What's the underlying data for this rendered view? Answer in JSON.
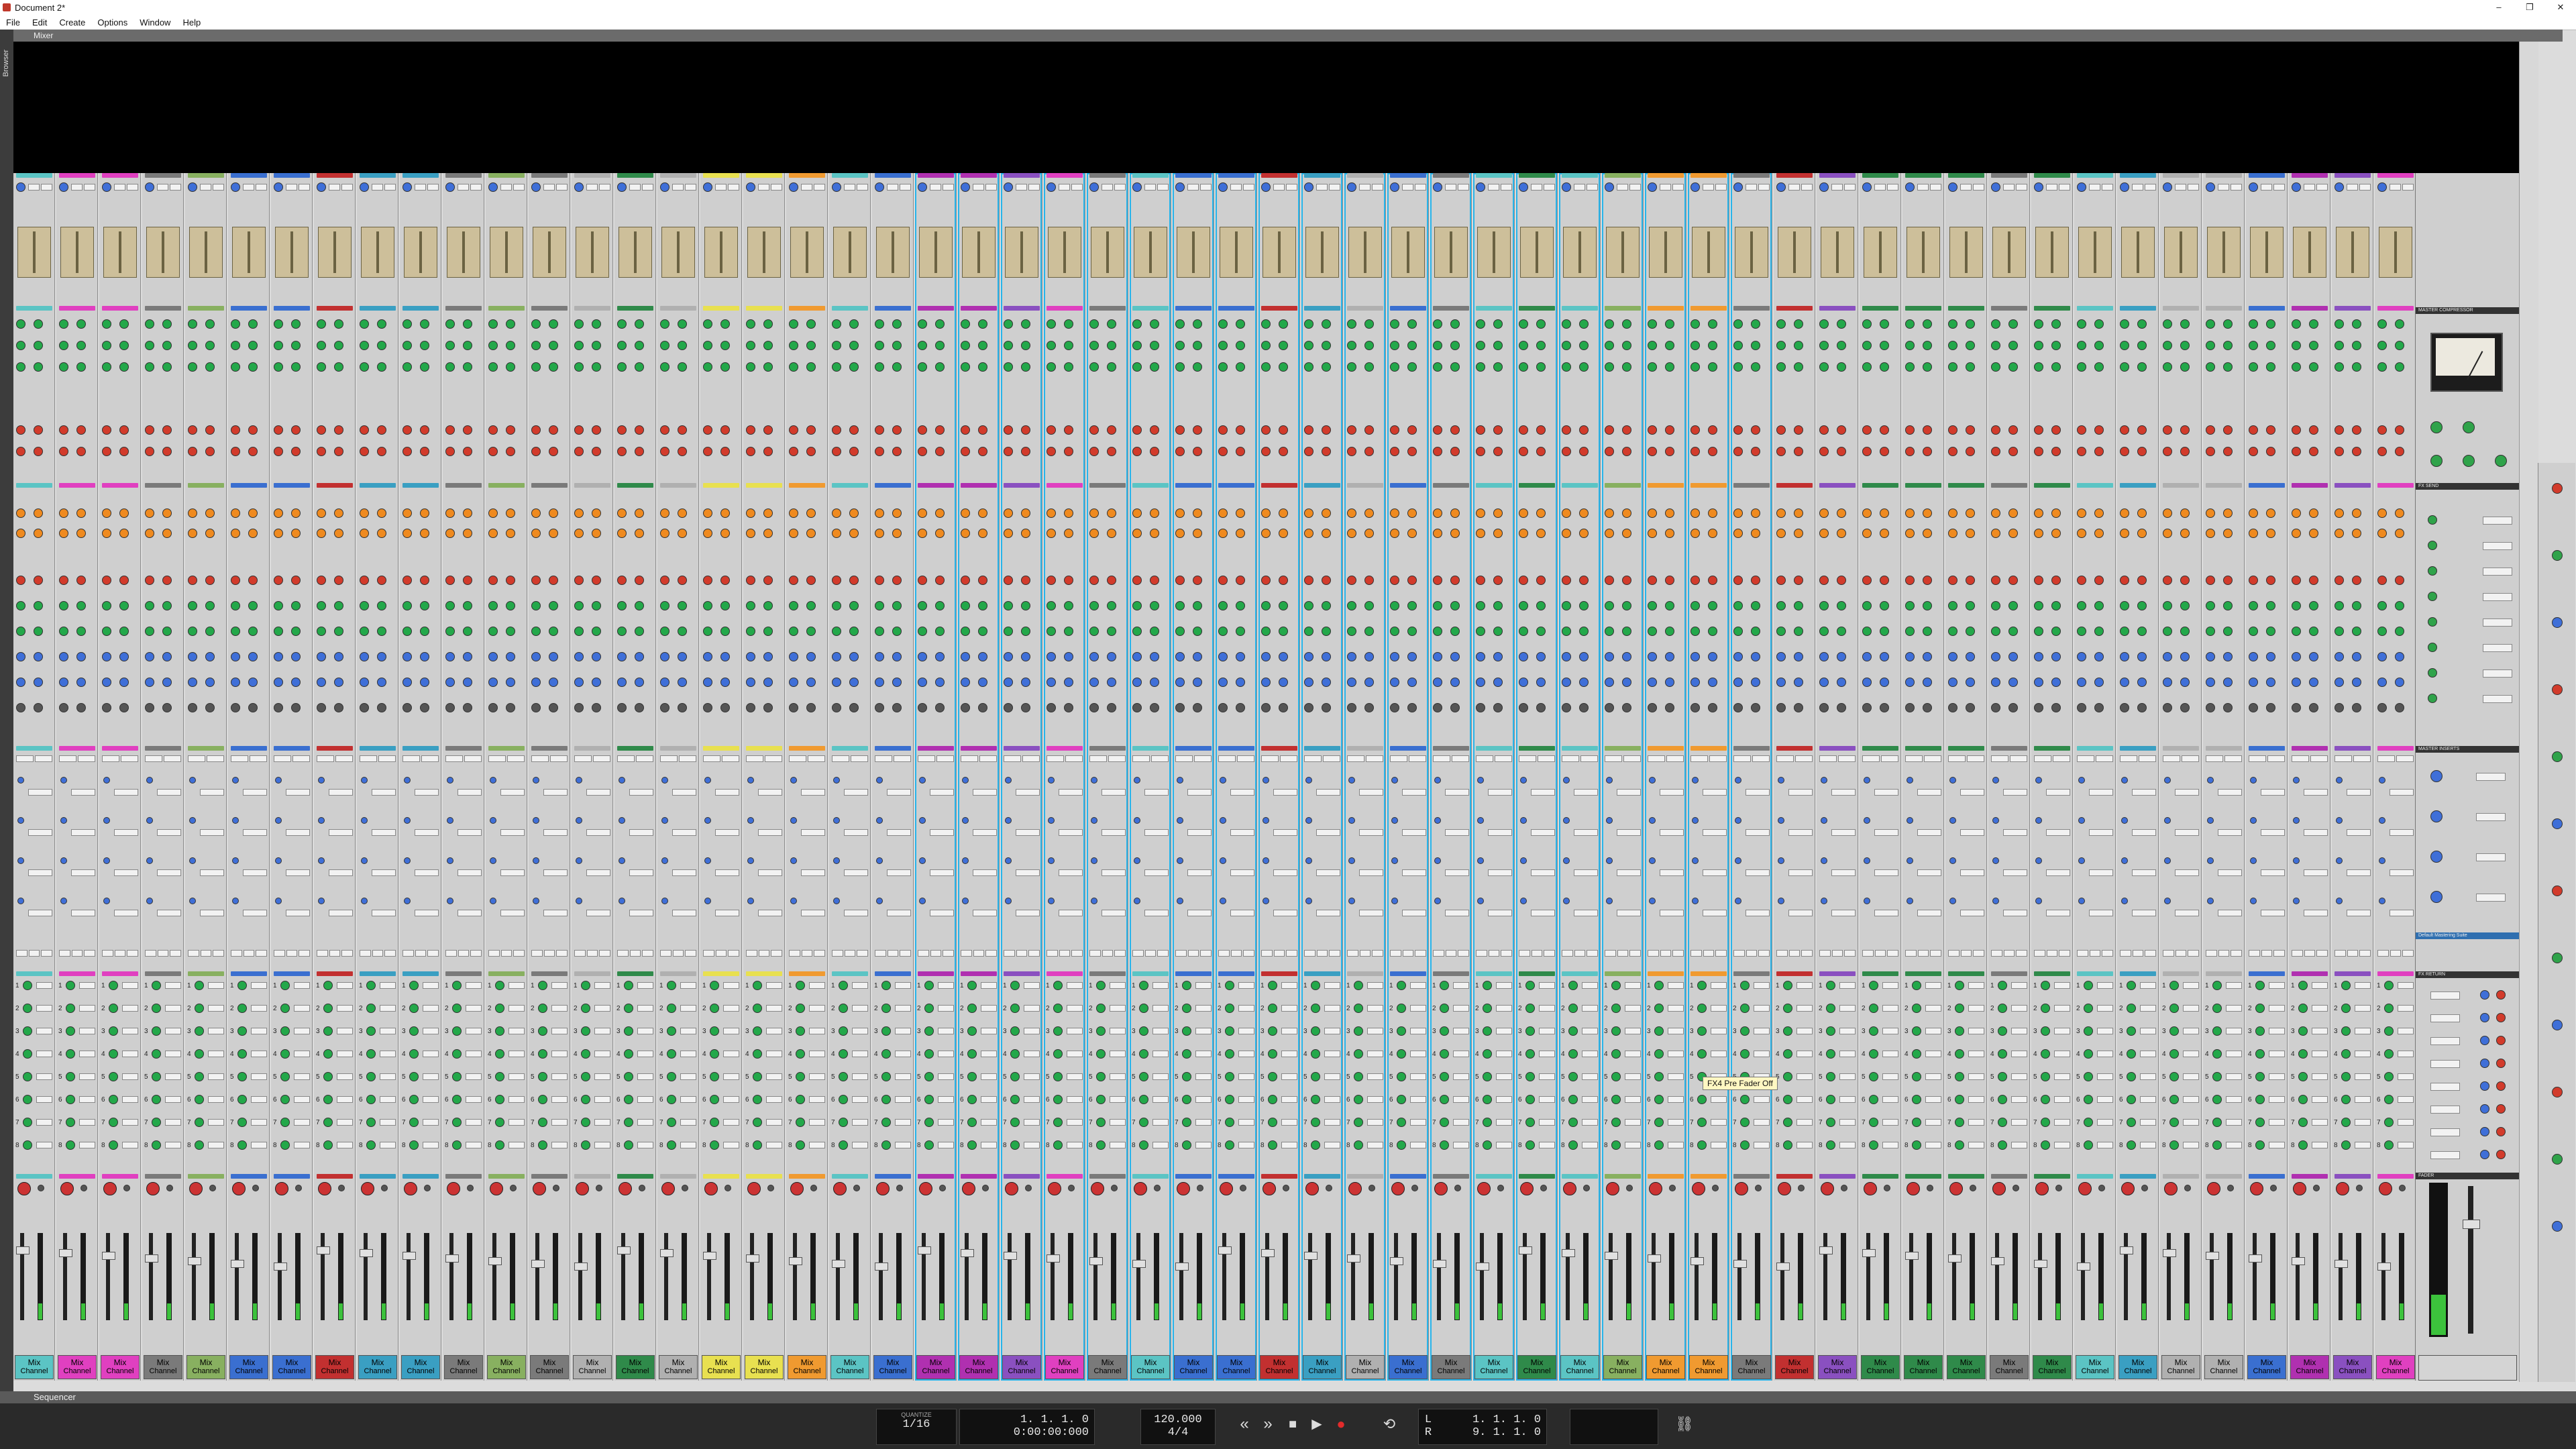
{
  "window": {
    "title": "Document 2*",
    "controls": [
      "–",
      "❐",
      "✕"
    ]
  },
  "menu": [
    "File",
    "Edit",
    "Create",
    "Options",
    "Window",
    "Help"
  ],
  "browser_tab": "Browser",
  "mixer": {
    "title": "Mixer"
  },
  "channel_palette": [
    "#5bc4c4",
    "#e040c0",
    "#e040c0",
    "#7a7a7a",
    "#88b060",
    "#3a6fd0",
    "#3a6fd0",
    "#c23030",
    "#3a9fc2",
    "#3a9fc2",
    "#7a7a7a",
    "#88b060",
    "#7a7a7a",
    "#b0b0b0",
    "#2f8a4a",
    "#b0b0b0",
    "#e8e050",
    "#e8e050",
    "#f09a30",
    "#5bc4c4",
    "#3a6fd0",
    "#b030b0",
    "#b030b0",
    "#8a50c0",
    "#e040c0",
    "#7a7a7a",
    "#5bc4c4",
    "#3a6fd0",
    "#3a6fd0",
    "#c23030",
    "#3a9fc2",
    "#b0b0b0",
    "#3a6fd0",
    "#7a7a7a",
    "#5bc4c4",
    "#2f8a4a",
    "#5bc4c4",
    "#88b060",
    "#f09a30",
    "#f09a30",
    "#7a7a7a",
    "#c23030",
    "#8a50c0",
    "#2f8a4a",
    "#2f8a4a",
    "#2f8a4a",
    "#7a7a7a",
    "#2f8a4a",
    "#5bc4c4",
    "#3a9fc2",
    "#b0b0b0",
    "#b0b0b0",
    "#3a6fd0",
    "#b030b0",
    "#8a50c0",
    "#e040c0"
  ],
  "channel_label": {
    "line1": "Mix",
    "line2": "Channel"
  },
  "bus_labels": [
    "1",
    "2",
    "3",
    "4",
    "5",
    "6",
    "7",
    "8"
  ],
  "master": {
    "compressor_header": "MASTER COMPRESSOR",
    "fx_send_header": "FX SEND",
    "inserts_header": "MASTER INSERTS",
    "inserts_preset": "Default Mastering Suite",
    "fx_return_header": "FX RETURN",
    "fader_header": "FADER"
  },
  "tooltip": "FX4 Pre Fader Off",
  "sequencer": {
    "title": "Sequencer"
  },
  "transport": {
    "quantize_label": "QUANTIZE",
    "quantize_value": "1/16",
    "position_bars": "1. 1. 1.   0",
    "position_time": "0:00:00:000",
    "tempo": "120.000",
    "signature": "4/4",
    "loop_L": "1. 1. 1.   0",
    "loop_R": "9. 1. 1.   0",
    "L": "L",
    "R": "R"
  }
}
